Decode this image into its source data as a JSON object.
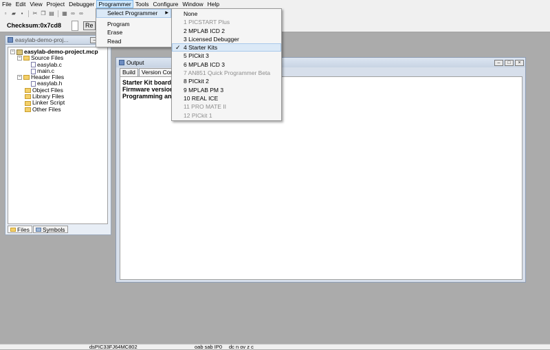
{
  "menubar": {
    "items": [
      "File",
      "Edit",
      "View",
      "Project",
      "Debugger",
      "Programmer",
      "Tools",
      "Configure",
      "Window",
      "Help"
    ],
    "active_index": 5
  },
  "toolbar": {
    "checksum": "Checksum:0x7cd8",
    "re_button_label": "Re"
  },
  "project_window": {
    "title": "easylab-demo-proj...",
    "tree": {
      "root": "easylab-demo-project.mcp",
      "source_files": "Source Files",
      "source_items": [
        "easylab.c",
        "main.c"
      ],
      "header_files": "Header Files",
      "header_items": [
        "easylab.h"
      ],
      "object_files": "Object Files",
      "library_files": "Library Files",
      "linker_script": "Linker Script",
      "other_files": "Other Files"
    },
    "tabs": [
      "Files",
      "Symbols"
    ]
  },
  "output_window": {
    "title": "Output",
    "tabs": [
      "Build",
      "Version Contro"
    ],
    "lines": [
      "Starter Kit board c",
      "Firmware version:",
      "Programming and v"
    ]
  },
  "programmer_menu": {
    "items": [
      "Select Programmer",
      "Program",
      "Erase",
      "Read"
    ]
  },
  "select_programmer_submenu": {
    "items": [
      {
        "label": "None",
        "enabled": true,
        "checked": false
      },
      {
        "label": "1 PICSTART Plus",
        "enabled": false,
        "checked": false
      },
      {
        "label": "2 MPLAB ICD 2",
        "enabled": true,
        "checked": false
      },
      {
        "label": "3 Licensed Debugger",
        "enabled": true,
        "checked": false
      },
      {
        "label": "4 Starter Kits",
        "enabled": true,
        "checked": true
      },
      {
        "label": "5 PICkit 3",
        "enabled": true,
        "checked": false
      },
      {
        "label": "6 MPLAB ICD 3",
        "enabled": true,
        "checked": false
      },
      {
        "label": "7 AN851 Quick Programmer Beta",
        "enabled": false,
        "checked": false
      },
      {
        "label": "8 PICkit 2",
        "enabled": true,
        "checked": false
      },
      {
        "label": "9 MPLAB PM 3",
        "enabled": true,
        "checked": false
      },
      {
        "label": "10 REAL ICE",
        "enabled": true,
        "checked": false
      },
      {
        "label": "11 PRO MATE II",
        "enabled": false,
        "checked": false
      },
      {
        "label": "12 PICkit 1",
        "enabled": false,
        "checked": false
      }
    ]
  },
  "statusbar": {
    "device": "dsPIC33FJ64MC802",
    "registers": "oab sab IP0",
    "flags": "dc n ov z c"
  },
  "colors": {
    "desktop": "#ababab",
    "menu_highlight": "#dbe9f7",
    "disabled_text": "#8d8d8d"
  }
}
